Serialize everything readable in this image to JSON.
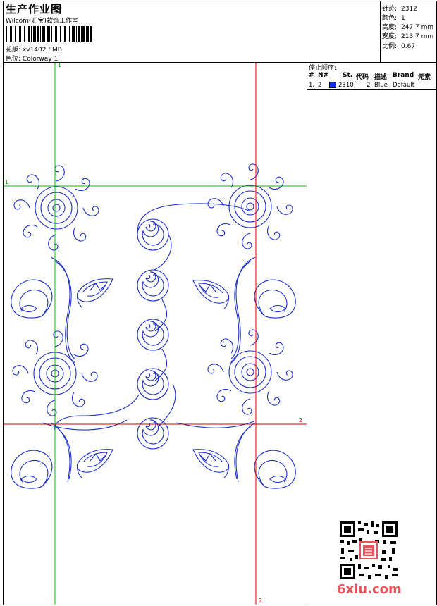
{
  "header": {
    "title": "生产作业图",
    "company": "Wilcom(汇宝)款饰工作室",
    "design_label": "花版:",
    "design_value": "xv1402.EMB",
    "colorway_label": "色位:",
    "colorway_value": "Colorway 1"
  },
  "stats": [
    {
      "label": "针迹:",
      "value": "2312"
    },
    {
      "label": "颜色:",
      "value": "1"
    },
    {
      "label": "高度:",
      "value": "247.7 mm"
    },
    {
      "label": "宽度:",
      "value": "213.7 mm"
    },
    {
      "label": "比例:",
      "value": "0.67"
    }
  ],
  "stop_sequence": {
    "title": "停止顺序:",
    "headers": [
      "#",
      "N#",
      "St.",
      "代码",
      "描述",
      "Brand",
      "元素"
    ],
    "rows": [
      {
        "index": "1.",
        "needle": "2",
        "stitches": "2310",
        "code": "2",
        "description": "Blue",
        "brand": "Default",
        "color": "#0a2ef2"
      }
    ]
  },
  "guides": {
    "vertical_green_label": "1",
    "horizontal_green_label": "1",
    "horizontal_red_label": "2",
    "vertical_red_label": "2"
  },
  "colors": {
    "thread": "#1a2fc8",
    "green_guide": "#00c000",
    "red_guide": "#e00000"
  },
  "watermark": {
    "text": "6xiu.com",
    "qr_icon": "qr-code-icon"
  }
}
